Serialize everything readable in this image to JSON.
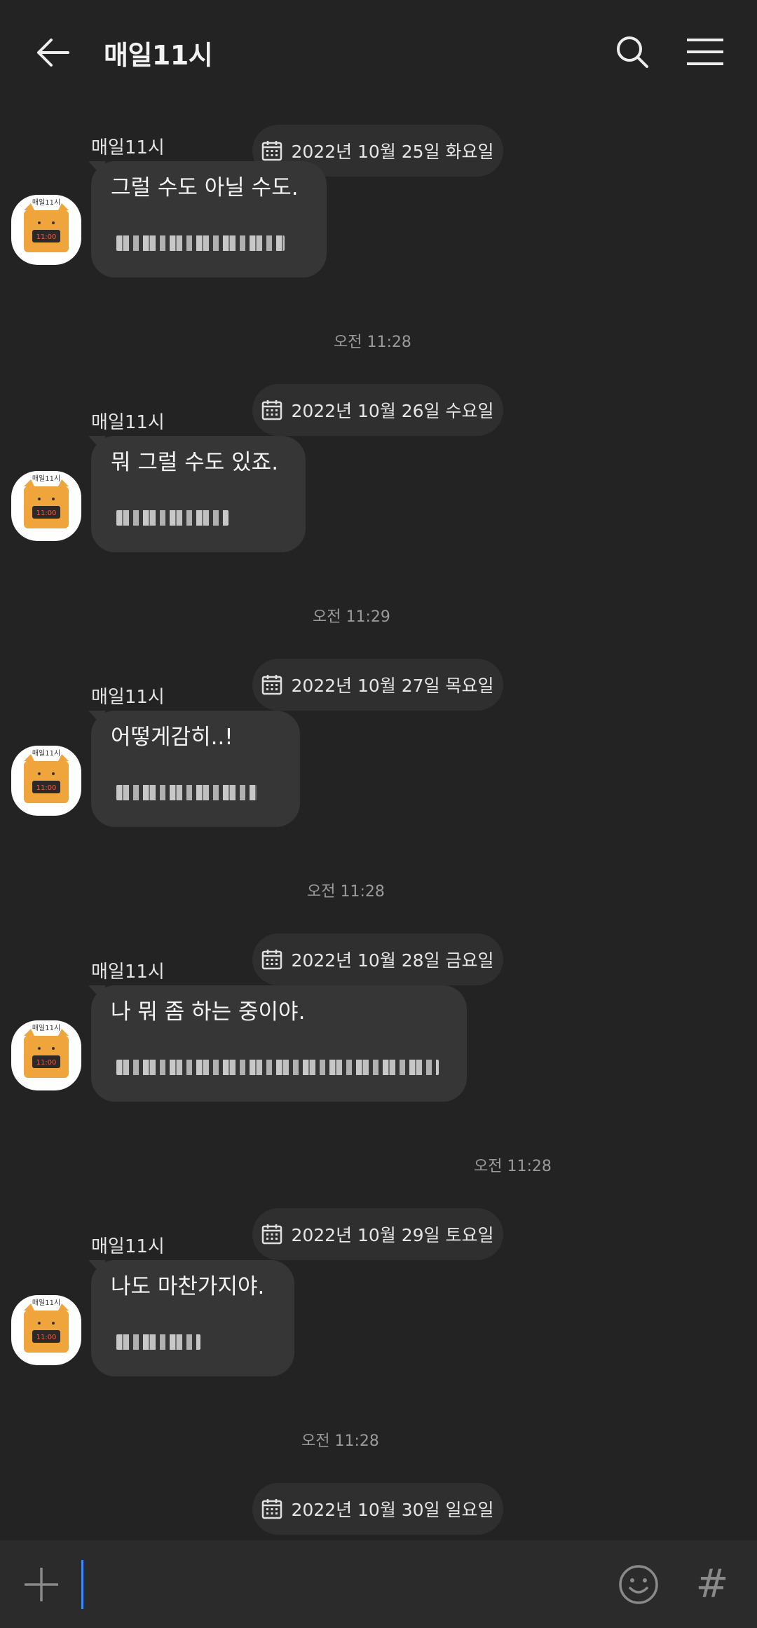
{
  "header": {
    "title": "매일11시",
    "back_icon": "back-arrow-icon",
    "search_icon": "search-icon",
    "menu_icon": "menu-icon"
  },
  "messages": [
    {
      "date": "2022년 10월 25일 화요일",
      "sender": "매일11시",
      "text": "그럴 수도 아닐 수도.",
      "time": "오전 11:28"
    },
    {
      "date": "2022년 10월 26일 수요일",
      "sender": "매일11시",
      "text": "뭐 그럴 수도 있죠.",
      "time": "오전 11:29"
    },
    {
      "date": "2022년 10월 27일 목요일",
      "sender": "매일11시",
      "text": "어떻게감히..!",
      "time": "오전 11:28"
    },
    {
      "date": "2022년 10월 28일 금요일",
      "sender": "매일11시",
      "text": "나 뭐 좀 하는 중이야.",
      "time": "오전 11:28"
    },
    {
      "date": "2022년 10월 29일 토요일",
      "sender": "매일11시",
      "text": "나도 마찬가지야.",
      "time": "오전 11:28"
    }
  ],
  "last_date": "2022년 10월 30일 일요일",
  "input": {
    "placeholder": "",
    "plus_icon": "plus-icon",
    "emoji_icon": "emoji-icon",
    "hash_label": "#"
  },
  "colors": {
    "background": "#232323",
    "bubble": "#363636",
    "date_pill": "#2f2f2f",
    "cursor": "#3d8bff",
    "avatar_orange": "#f0a43c"
  }
}
